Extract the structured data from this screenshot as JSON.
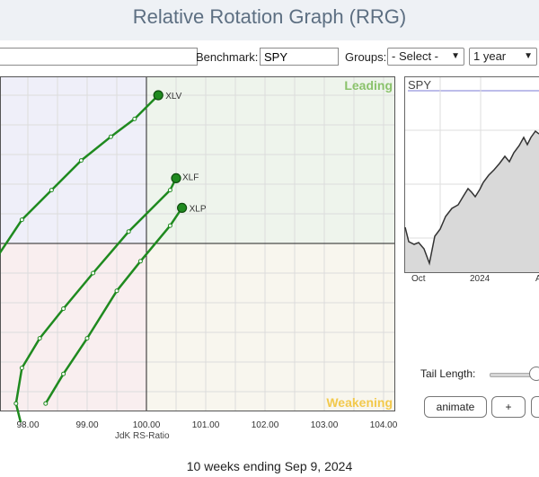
{
  "header": {
    "title": "Relative Rotation Graph (RRG)"
  },
  "toolbar": {
    "symbols_value": "",
    "benchmark_label": "Benchmark:",
    "benchmark_value": "SPY",
    "groups_label": "Groups:",
    "groups_selected": "- Select -",
    "period_selected": "1 year"
  },
  "chart": {
    "quadrant_leading": "Leading",
    "quadrant_weakening": "Weakening",
    "x_axis_title": "JdK RS-Ratio",
    "x_ticks": [
      "98.00",
      "99.00",
      "100.00",
      "101.00",
      "102.00",
      "103.00",
      "104.00"
    ],
    "colors": {
      "leading_bg": "#eef4ec",
      "weakening_bg": "#f8f6ee",
      "lagging_bg": "#f9eeef",
      "improving_bg": "#efeff9",
      "tail": "#1f8a1f",
      "leading_text": "#8ac26b",
      "weakening_text": "#f2c94c"
    }
  },
  "chart_data": {
    "type": "scatter",
    "xlabel": "JdK RS-Ratio",
    "xlim": [
      97.5,
      104.2
    ],
    "center": [
      100,
      100
    ],
    "series": [
      {
        "name": "XLV",
        "points": [
          [
            96.6,
            98.2
          ],
          [
            97.0,
            98.9
          ],
          [
            97.5,
            99.8
          ],
          [
            97.9,
            100.4
          ],
          [
            98.4,
            100.9
          ],
          [
            98.9,
            101.4
          ],
          [
            99.4,
            101.8
          ],
          [
            99.8,
            102.1
          ],
          [
            100.2,
            102.5
          ]
        ]
      },
      {
        "name": "XLF",
        "points": [
          [
            98.5,
            96.8
          ],
          [
            98.2,
            96.8
          ],
          [
            97.9,
            96.9
          ],
          [
            97.8,
            97.3
          ],
          [
            97.9,
            97.9
          ],
          [
            98.2,
            98.4
          ],
          [
            98.6,
            98.9
          ],
          [
            99.1,
            99.5
          ],
          [
            99.7,
            100.2
          ],
          [
            100.4,
            100.9
          ],
          [
            100.5,
            101.1
          ]
        ]
      },
      {
        "name": "XLP",
        "points": [
          [
            98.3,
            97.3
          ],
          [
            98.6,
            97.8
          ],
          [
            99.0,
            98.4
          ],
          [
            99.5,
            99.2
          ],
          [
            99.9,
            99.7
          ],
          [
            100.4,
            100.3
          ],
          [
            100.6,
            100.6
          ]
        ]
      }
    ]
  },
  "benchmark_chart": {
    "label": "SPY",
    "x_ticks": [
      "Oct",
      "2024",
      "A"
    ]
  },
  "controls": {
    "tail_length_label": "Tail Length:",
    "animate_label": "animate",
    "plus_label": "+",
    "extra_label": ""
  },
  "footer": {
    "date_range": "10 weeks ending Sep 9, 2024"
  }
}
